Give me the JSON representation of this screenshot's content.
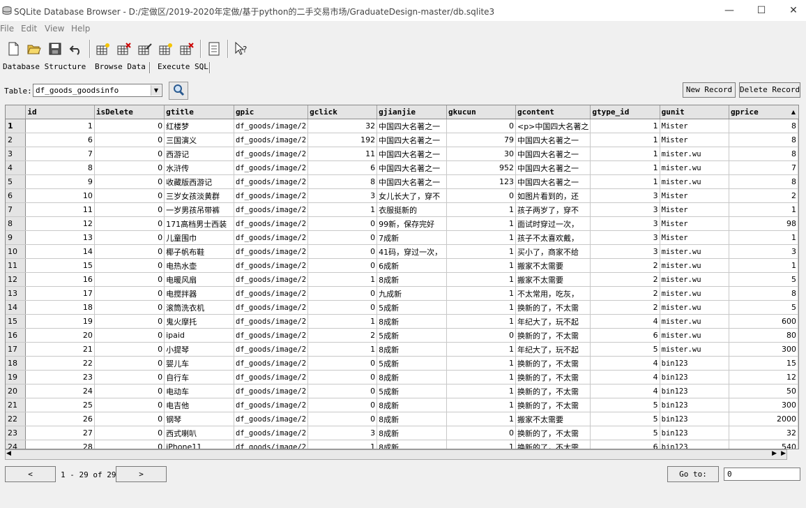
{
  "window": {
    "title": "SQLite Database Browser - D:/定做区/2019-2020年定做/基于python的二手交易市场/GraduateDesign-master/db.sqlite3",
    "minimize": "—",
    "maximize": "☐",
    "close": "✕"
  },
  "menu": {
    "file": "File",
    "edit": "Edit",
    "view": "View",
    "help": "Help"
  },
  "tabs": {
    "structure": "Database Structure",
    "browse": "Browse Data",
    "execute": "Execute SQL"
  },
  "browse": {
    "table_label": "Table:",
    "table_selected": "df_goods_goodsinfo",
    "new_record": "New Record",
    "delete_record": "Delete Record"
  },
  "columns": [
    "id",
    "isDelete",
    "gtitle",
    "gpic",
    "gclick",
    "gjianjie",
    "gkucun",
    "gcontent",
    "gtype_id",
    "gunit",
    "gprice"
  ],
  "rows": [
    [
      "1",
      "1",
      "0",
      "红楼梦",
      "df_goods/image/2",
      "32",
      "中国四大名著之一",
      "0",
      "<p>中国四大名著之",
      "1",
      "Mister",
      "8"
    ],
    [
      "2",
      "6",
      "0",
      "三国演义",
      "df_goods/image/2",
      "192",
      "中国四大名著之一",
      "79",
      "中国四大名著之一",
      "1",
      "Mister",
      "8"
    ],
    [
      "3",
      "7",
      "0",
      "西游记",
      "df_goods/image/2",
      "11",
      "中国四大名著之一",
      "30",
      "中国四大名著之一",
      "1",
      "mister.wu",
      "8"
    ],
    [
      "4",
      "8",
      "0",
      "水浒传",
      "df_goods/image/2",
      "6",
      "中国四大名著之一",
      "952",
      "中国四大名著之一",
      "1",
      "mister.wu",
      "7"
    ],
    [
      "5",
      "9",
      "0",
      "收藏版西游记",
      "df_goods/image/2",
      "8",
      "中国四大名著之一",
      "123",
      "中国四大名著之一",
      "1",
      "mister.wu",
      "8"
    ],
    [
      "6",
      "10",
      "0",
      "三岁女孩淡黄群",
      "df_goods/image/2",
      "3",
      "女儿长大了，穿不",
      "0",
      "如图片看到的，还",
      "3",
      "Mister",
      "2"
    ],
    [
      "7",
      "11",
      "0",
      "一岁男孩吊带裤",
      "df_goods/image/2",
      "1",
      "衣服挺新的",
      "1",
      "孩子两岁了，穿不",
      "3",
      "Mister",
      "1"
    ],
    [
      "8",
      "12",
      "0",
      "171高档男士西装",
      "df_goods/image/2",
      "0",
      "99新，保存完好",
      "1",
      "面试时穿过一次，",
      "3",
      "Mister",
      "98"
    ],
    [
      "9",
      "13",
      "0",
      "儿童围巾",
      "df_goods/image/2",
      "0",
      "7成新",
      "1",
      "孩子不太喜欢戴，",
      "3",
      "Mister",
      "1"
    ],
    [
      "10",
      "14",
      "0",
      "椰子帆布鞋",
      "df_goods/image/2",
      "0",
      "41码，穿过一次，",
      "1",
      "买小了，商家不给",
      "3",
      "mister.wu",
      "3"
    ],
    [
      "11",
      "15",
      "0",
      "电热水壶",
      "df_goods/image/2",
      "0",
      "6成新",
      "1",
      "搬家不太需要",
      "2",
      "mister.wu",
      "1"
    ],
    [
      "12",
      "16",
      "0",
      "电暖风扇",
      "df_goods/image/2",
      "1",
      "8成新",
      "1",
      "搬家不太需要",
      "2",
      "mister.wu",
      "5"
    ],
    [
      "13",
      "17",
      "0",
      "电搅拌器",
      "df_goods/image/2",
      "0",
      "九成新",
      "1",
      "不太常用，吃灰，",
      "2",
      "mister.wu",
      "8"
    ],
    [
      "14",
      "18",
      "0",
      "滚筒洗衣机",
      "df_goods/image/2",
      "0",
      "5成新",
      "1",
      "换新的了，不太需",
      "2",
      "mister.wu",
      "5"
    ],
    [
      "15",
      "19",
      "0",
      "鬼火摩托",
      "df_goods/image/2",
      "1",
      "8成新",
      "1",
      "年纪大了，玩不起",
      "4",
      "mister.wu",
      "600"
    ],
    [
      "16",
      "20",
      "0",
      "ipaid",
      "df_goods/image/2",
      "2",
      "5成新",
      "0",
      "换新的了，不太需",
      "6",
      "mister.wu",
      "80"
    ],
    [
      "17",
      "21",
      "0",
      "小提琴",
      "df_goods/image/2",
      "1",
      "8成新",
      "1",
      "年纪大了，玩不起",
      "5",
      "mister.wu",
      "300"
    ],
    [
      "18",
      "22",
      "0",
      "婴儿车",
      "df_goods/image/2",
      "0",
      "5成新",
      "1",
      "换新的了，不太需",
      "4",
      "bin123",
      "15"
    ],
    [
      "19",
      "23",
      "0",
      "自行车",
      "df_goods/image/2",
      "0",
      "8成新",
      "1",
      "换新的了，不太需",
      "4",
      "bin123",
      "12"
    ],
    [
      "20",
      "24",
      "0",
      "电动车",
      "df_goods/image/2",
      "0",
      "5成新",
      "1",
      "换新的了，不太需",
      "4",
      "bin123",
      "50"
    ],
    [
      "21",
      "25",
      "0",
      "电吉他",
      "df_goods/image/2",
      "0",
      "8成新",
      "1",
      "换新的了，不太需",
      "5",
      "bin123",
      "300"
    ],
    [
      "22",
      "26",
      "0",
      "钢琴",
      "df_goods/image/2",
      "0",
      "8成新",
      "1",
      "搬家不太需要",
      "5",
      "bin123",
      "2000"
    ],
    [
      "23",
      "27",
      "0",
      "西式喇叭",
      "df_goods/image/2",
      "3",
      "8成新",
      "0",
      "换新的了，不太需",
      "5",
      "bin123",
      "32"
    ],
    [
      "24",
      "28",
      "0",
      "iPhone11",
      "df_goods/image/2",
      "1",
      "8成新",
      "1",
      "换新的了，不太需",
      "6",
      "bin123",
      "540"
    ]
  ],
  "pager": {
    "prev": "<",
    "status": "1 - 29 of 29",
    "next": ">",
    "goto_label": "Go to:",
    "goto_value": "0"
  }
}
